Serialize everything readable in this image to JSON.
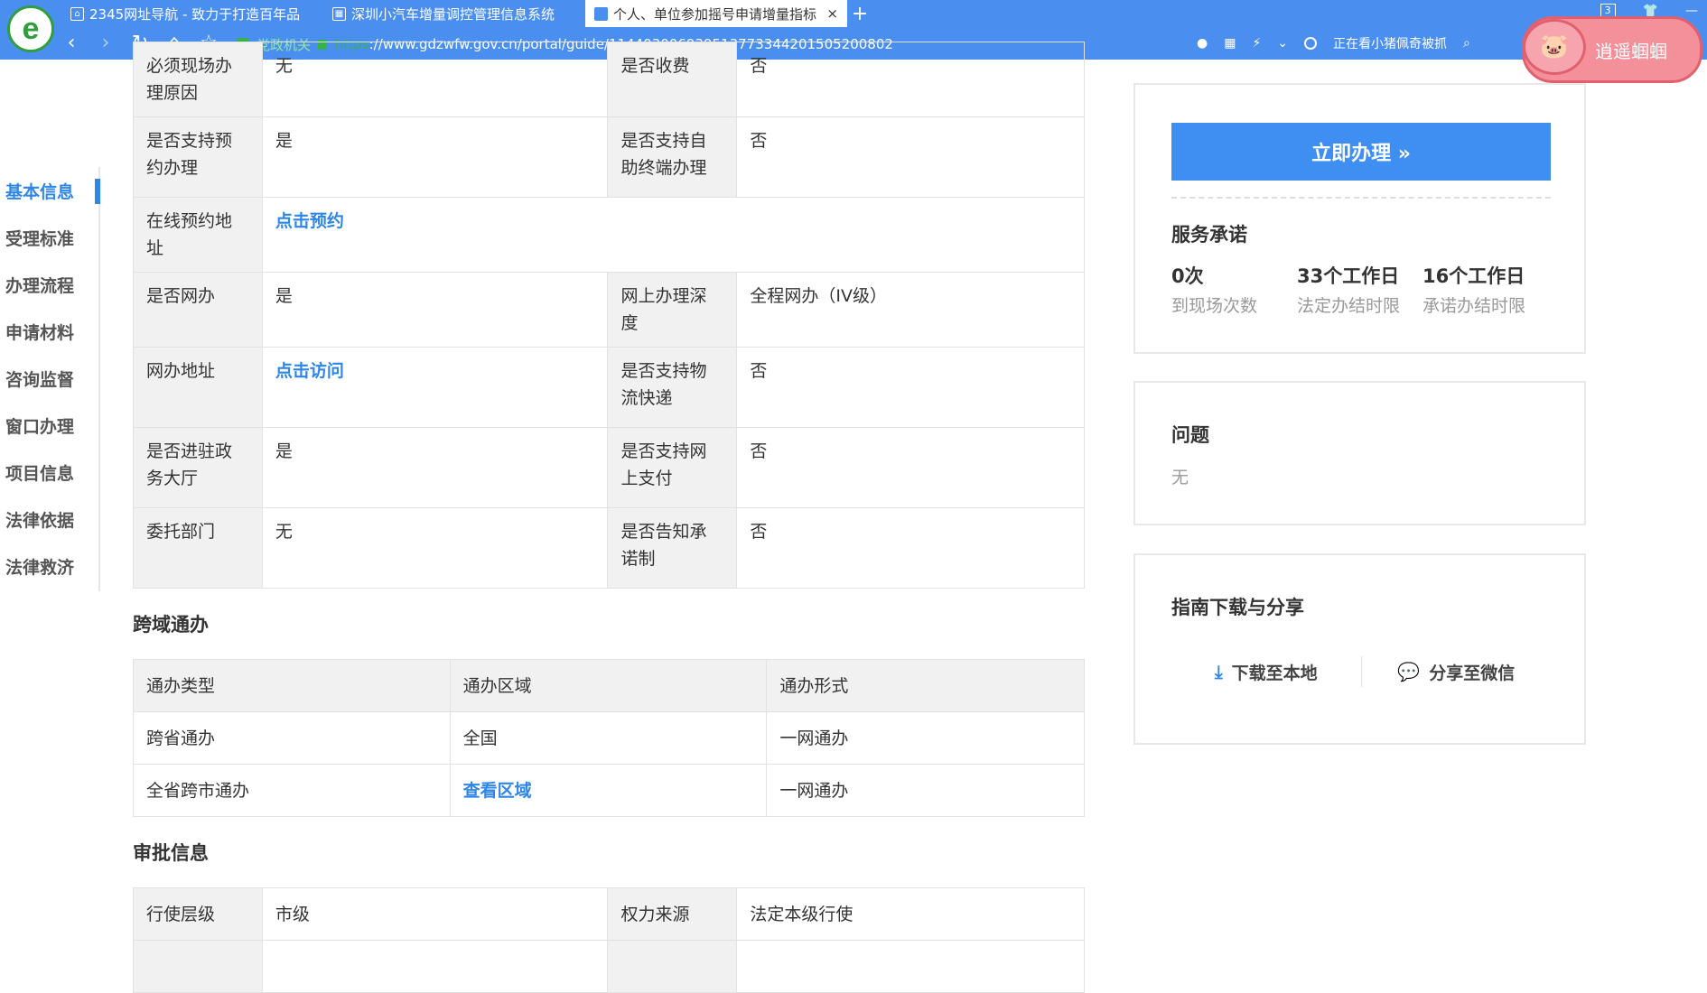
{
  "browser": {
    "logo_letter": "e",
    "tabs": [
      {
        "title": "2345网址导航 - 致力于打造百年品",
        "active": false,
        "icon": "house-icon"
      },
      {
        "title": "深圳小汽车增量调控管理信息系统",
        "active": false,
        "icon": "page-icon"
      },
      {
        "title": "个人、单位参加摇号申请增量指标",
        "active": true,
        "icon": "page-icon"
      }
    ],
    "new_tab": "+",
    "window_badge": "3",
    "address": {
      "site_label": "党政机关",
      "scheme": "https",
      "url": "://www.gdzwfw.gov.cn/portal/guide/11440300693951377334420150520080​2"
    },
    "status_text": "正在看小猪佩奇被抓",
    "mascot_text": "逍遥蝈蝈"
  },
  "left_nav": {
    "items": [
      {
        "label": "基本信息",
        "active": true
      },
      {
        "label": "受理标准",
        "active": false
      },
      {
        "label": "办理流程",
        "active": false
      },
      {
        "label": "申请材料",
        "active": false
      },
      {
        "label": "咨询监督",
        "active": false
      },
      {
        "label": "窗口办理",
        "active": false
      },
      {
        "label": "项目信息",
        "active": false
      },
      {
        "label": "法律依据",
        "active": false
      },
      {
        "label": "法律救济",
        "active": false
      }
    ]
  },
  "basic_table": {
    "rows": [
      {
        "k1": "必须现场办理原因",
        "v1": "无",
        "k2": "是否收费",
        "v2": "否"
      },
      {
        "k1": "是否支持预约办理",
        "v1": "是",
        "k2": "是否支持自助终端办理",
        "v2": "否"
      },
      {
        "k1": "在线预约地址",
        "v1": "点击预约",
        "link": true
      },
      {
        "k1": "是否网办",
        "v1": "是",
        "k2": "网上办理深度",
        "v2": "全程网办（IV级）"
      },
      {
        "k1": "网办地址",
        "v1": "点击访问",
        "v1_link": true,
        "k2": "是否支持物流快递",
        "v2": "否"
      },
      {
        "k1": "是否进驻政务大厅",
        "v1": "是",
        "k2": "是否支持网上支付",
        "v2": "否"
      },
      {
        "k1": "委托部门",
        "v1": "无",
        "k2": "是否告知承诺制",
        "v2": "否"
      }
    ]
  },
  "cross_region": {
    "title": "跨域通办",
    "headers": [
      "通办类型",
      "通办区域",
      "通办形式"
    ],
    "rows": [
      [
        "跨省通办",
        "全国",
        "一网通办"
      ],
      [
        "全省跨市通办",
        "查看区域",
        "一网通办"
      ]
    ]
  },
  "approval": {
    "title": "审批信息",
    "rows": [
      {
        "k1": "行使层级",
        "v1": "市级",
        "k2": "权力来源",
        "v2": "法定本级行使"
      }
    ]
  },
  "sidebar": {
    "do_button": "立即办理 »",
    "service_title": "服务承诺",
    "stats": [
      {
        "value": "0次",
        "label": "到现场次数"
      },
      {
        "value": "33个工作日",
        "label": "法定办结时限"
      },
      {
        "value": "16个工作日",
        "label": "承诺办结时限"
      }
    ],
    "problem_title": "问题",
    "problem_answer": "无",
    "download_title": "指南下载与分享",
    "download_label": "下载至本地",
    "share_label": "分享至微信"
  }
}
